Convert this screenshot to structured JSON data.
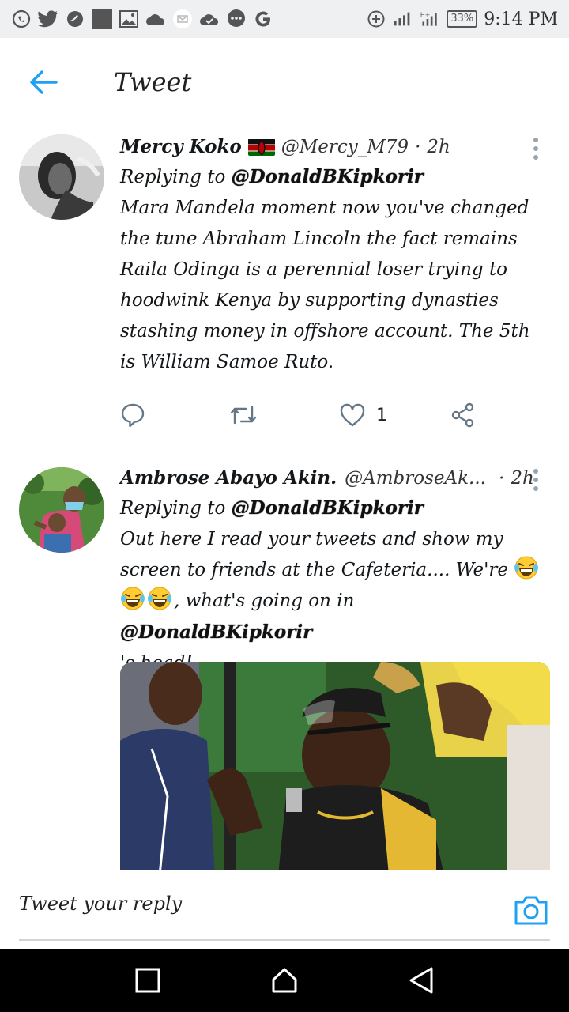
{
  "status_bar": {
    "left_icons": [
      "whatsapp-icon",
      "twitter-icon",
      "hummingbird-icon",
      "app-square-icon",
      "image-icon",
      "cloud-icon",
      "mail-icon",
      "cloud-check-icon",
      "chat-icon",
      "google-icon"
    ],
    "battery": "33%",
    "time": "9:14 PM"
  },
  "header": {
    "title": "Tweet"
  },
  "tweets": [
    {
      "name": "Mercy Koko",
      "handle": "@Mercy_M79",
      "separator": "·",
      "time": "2h",
      "replying_label": "Replying to",
      "replying_to": "@DonaldBKipkorir",
      "text": "Mara Mandela moment now you've changed the tune Abraham Lincoln the fact remains Raila Odinga is a perennial loser trying to hoodwink Kenya by supporting dynasties stashing money in offshore account. The 5th is William Samoe Ruto.",
      "likes": "1"
    },
    {
      "name": "Ambrose Abayo Akin.",
      "handle": "@AmbroseAk...",
      "separator": "·",
      "time": "2h",
      "replying_label": "Replying to",
      "replying_to": "@DonaldBKipkorir",
      "text_a": "Out here I read your tweets and show my screen to friends at the Cafeteria.... We're",
      "text_b": ", what's going on in",
      "mention": "@DonaldBKipkorir",
      "text_c": "'s head!"
    }
  ],
  "reply_bar": {
    "placeholder": "Tweet your reply"
  },
  "colors": {
    "accent": "#1da1f2",
    "icon_grey": "#657786",
    "divider": "#d8dde1"
  }
}
